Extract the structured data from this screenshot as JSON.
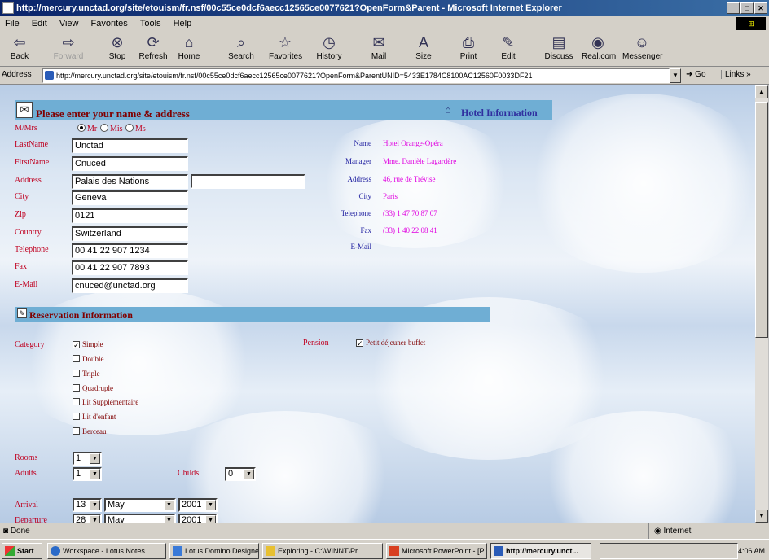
{
  "window": {
    "title": "http://mercury.unctad.org/site/etouism/fr.nsf/00c55ce0dcf6aecc12565ce0077621?OpenForm&Parent - Microsoft Internet Explorer"
  },
  "menu": [
    "File",
    "Edit",
    "View",
    "Favorites",
    "Tools",
    "Help"
  ],
  "toolbar": [
    {
      "label": "Back",
      "icon": "back-arrow-icon"
    },
    {
      "label": "Forward",
      "icon": "forward-arrow-icon"
    },
    {
      "label": "Stop",
      "icon": "stop-icon"
    },
    {
      "label": "Refresh",
      "icon": "refresh-icon"
    },
    {
      "label": "Home",
      "icon": "home-icon"
    },
    {
      "label": "Search",
      "icon": "search-icon"
    },
    {
      "label": "Favorites",
      "icon": "favorites-icon"
    },
    {
      "label": "History",
      "icon": "history-icon"
    },
    {
      "label": "Mail",
      "icon": "mail-icon"
    },
    {
      "label": "Size",
      "icon": "size-icon"
    },
    {
      "label": "Print",
      "icon": "print-icon"
    },
    {
      "label": "Edit",
      "icon": "edit-icon"
    },
    {
      "label": "Discuss",
      "icon": "discuss-icon"
    },
    {
      "label": "Real.com",
      "icon": "realcom-icon"
    },
    {
      "label": "Messenger",
      "icon": "messenger-icon"
    }
  ],
  "address": {
    "label": "Address",
    "url": "http://mercury.unctad.org/site/etouism/fr.nsf/00c55ce0dcf6aecc12565ce0077621?OpenForm&ParentUNID=5433E1784C8100AC12560F0033DF21",
    "go": "Go",
    "links": "Links"
  },
  "form": {
    "title": "Please enter your name & address",
    "labels": {
      "title": "M/Mrs",
      "lastname": "LastName",
      "firstname": "FirstName",
      "address": "Address",
      "city": "City",
      "zip": "Zip",
      "country": "Country",
      "telephone": "Telephone",
      "fax": "Fax",
      "email": "E-Mail"
    },
    "salutations": [
      {
        "label": "Mr",
        "selected": true
      },
      {
        "label": "Mis",
        "selected": false
      },
      {
        "label": "Ms",
        "selected": false
      }
    ],
    "values": {
      "lastname": "Unctad",
      "firstname": "Cnuced",
      "address1": "Palais des Nations",
      "address2": "",
      "city": "Geneva",
      "zip": "0121",
      "country": "Switzerland",
      "telephone": "00 41 22 907 1234",
      "fax": "00 41 22 907 7893",
      "email": "cnuced@unctad.org"
    }
  },
  "hotel": {
    "title": "Hotel Information",
    "rows": [
      {
        "label": "Name",
        "value": "Hotel Orange-Opéra"
      },
      {
        "label": "Manager",
        "value": "Mme. Danièle Lagardère"
      },
      {
        "label": "Address",
        "value": "46, rue de Trévise"
      },
      {
        "label": "City",
        "value": "Paris"
      },
      {
        "label": "Telephone",
        "value": "(33) 1 47 70 87 07"
      },
      {
        "label": "Fax",
        "value": "(33) 1 40 22 08 41"
      },
      {
        "label": "E-Mail",
        "value": ""
      }
    ]
  },
  "reservation": {
    "title": "Reservation Information",
    "category_label": "Category",
    "categories": [
      {
        "label": "Simple",
        "checked": true
      },
      {
        "label": "Double",
        "checked": false
      },
      {
        "label": "Triple",
        "checked": false
      },
      {
        "label": "Quadruple",
        "checked": false
      },
      {
        "label": "Lit Supplémentaire",
        "checked": false
      },
      {
        "label": "Lit d'enfant",
        "checked": false
      },
      {
        "label": "Berceau",
        "checked": false
      }
    ],
    "pension_label": "Pension",
    "pension_option": "Petit déjeuner buffet",
    "pension_checked": true,
    "rooms_label": "Rooms",
    "rooms": "1",
    "adults_label": "Adults",
    "adults": "1",
    "childs_label": "Childs",
    "childs": "0",
    "arrival_label": "Arrival",
    "arrival": {
      "day": "13",
      "month": "May",
      "year": "2001"
    },
    "departure_label": "Departure",
    "departure": {
      "day": "28",
      "month": "May",
      "year": "2001"
    }
  },
  "status": {
    "left": "Done",
    "zone": "Internet"
  },
  "taskbar": {
    "start": "Start",
    "tasks": [
      {
        "label": "Workspace - Lotus Notes",
        "active": false
      },
      {
        "label": "Lotus Domino Designer",
        "active": false
      },
      {
        "label": "Exploring - C:\\WINNT\\Pr...",
        "active": false
      },
      {
        "label": "Microsoft PowerPoint - [P...",
        "active": false
      },
      {
        "label": "http://mercury.unct...",
        "active": true
      }
    ],
    "clock": "4:06 AM"
  },
  "colors": {
    "title_bar": "#0a246a",
    "section_bar": "#6faed4",
    "form_label": "#c00020",
    "hotel_label": "#2020a0",
    "hotel_value": "#e000e0"
  }
}
